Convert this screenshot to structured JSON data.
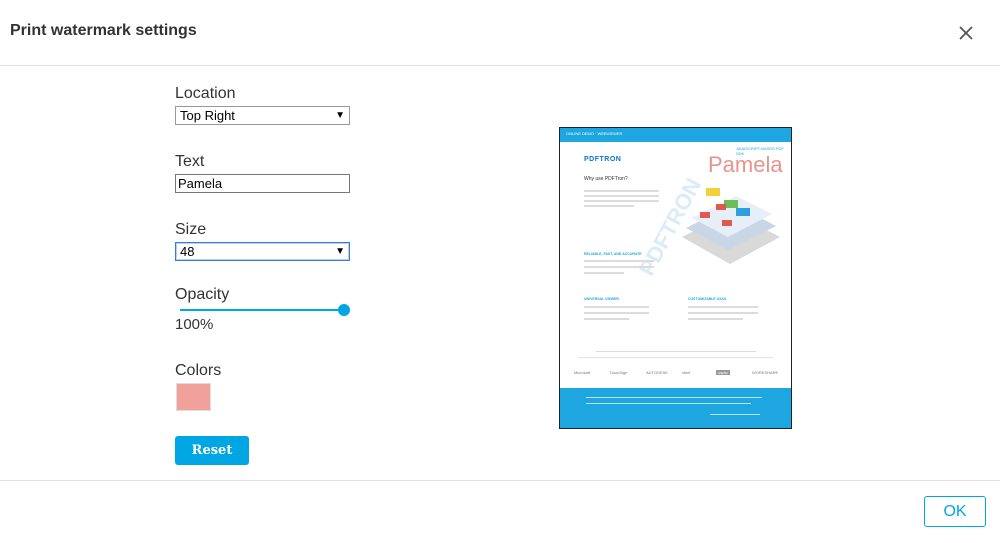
{
  "dialog": {
    "title": "Print watermark settings"
  },
  "location": {
    "label": "Location",
    "value": "Top Right"
  },
  "text": {
    "label": "Text",
    "value": "Pamela"
  },
  "size": {
    "label": "Size",
    "value": "48"
  },
  "opacity": {
    "label": "Opacity",
    "value_text": "100%",
    "level": 1.0
  },
  "colors": {
    "label": "Colors",
    "selected": "#f1a09a"
  },
  "buttons": {
    "reset": "Reset",
    "ok": "OK"
  },
  "preview": {
    "watermark_text": "Pamela",
    "topbar_text": "ONLINE DEMO · WEBVIEWER",
    "logo_text": "PDFTRON",
    "tag_text": "JAVASCRIPT-BASED PDF SDK",
    "heading_text": "Why use PDFTron?",
    "sub_1": "RELIABLE, FAST, AND ACCURATE",
    "sub_2": "UNIVERSAL VIEWER",
    "sub_3": "CUSTOMIZABLE UX/UI",
    "brand_logos": [
      "Microsoft",
      "DocuSign",
      "AUTODESK",
      "xfinit",
      "uspto",
      "WORKSHARE"
    ],
    "faint_watermark": "PDFTRON"
  },
  "colors_theme": {
    "accent": "#00a5e4",
    "preview_blue": "#1ea6e0",
    "watermark_color": "#e1787399"
  }
}
